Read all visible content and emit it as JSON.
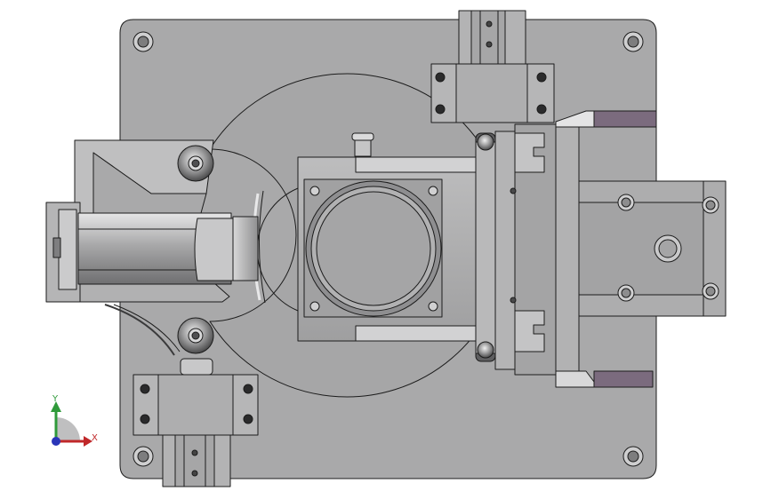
{
  "viewport": {
    "background": "#ffffff",
    "part_fill": "#a9a9aa",
    "part_light": "#c2c2c3",
    "part_dark": "#8e8e90",
    "edge_color": "#1c1c1c",
    "accent_purple": "#7b6b7e"
  },
  "triad": {
    "x_label": "X",
    "y_label": "Y",
    "x_color": "#c0282a",
    "y_color": "#2f9a3a",
    "z_color": "#2a35b8"
  }
}
